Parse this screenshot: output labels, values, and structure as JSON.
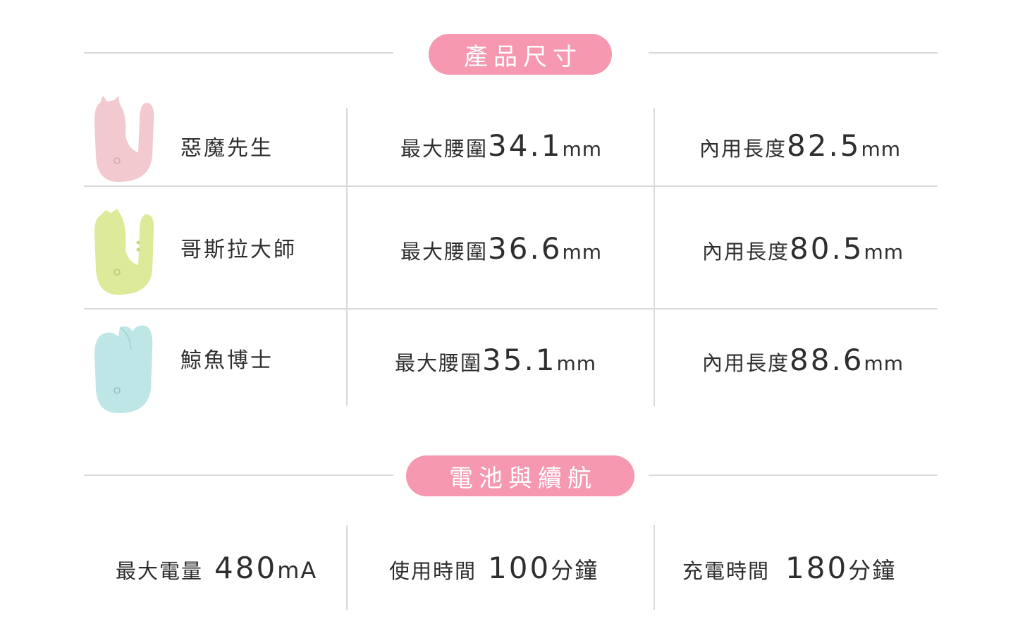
{
  "sections": {
    "size_title": "產品尺寸",
    "battery_title": "電池與續航"
  },
  "colors": {
    "pill": "#f598b0",
    "product_pink": "#f2c9cf",
    "product_green": "#dcea9a",
    "product_blue": "#bfe6e6"
  },
  "products": [
    {
      "name": "惡魔先生",
      "waist_label": "最大腰圍",
      "waist_value": "34.1",
      "waist_unit": "mm",
      "length_label": "內用長度",
      "length_value": "82.5",
      "length_unit": "mm",
      "icon": "pink-device-image"
    },
    {
      "name": "哥斯拉大師",
      "waist_label": "最大腰圍",
      "waist_value": "36.6",
      "waist_unit": "mm",
      "length_label": "內用長度",
      "length_value": "80.5",
      "length_unit": "mm",
      "icon": "green-device-image"
    },
    {
      "name": "鯨魚博士",
      "waist_label": "最大腰圍",
      "waist_value": "35.1",
      "waist_unit": "mm",
      "length_label": "內用長度",
      "length_value": "88.6",
      "length_unit": "mm",
      "icon": "blue-device-image"
    }
  ],
  "battery": {
    "capacity_label": "最大電量",
    "capacity_value": "480",
    "capacity_unit": "mA",
    "use_label": "使用時間",
    "use_value": "100",
    "use_unit": "分鐘",
    "charge_label": "充電時間",
    "charge_value": "180",
    "charge_unit": "分鐘"
  }
}
